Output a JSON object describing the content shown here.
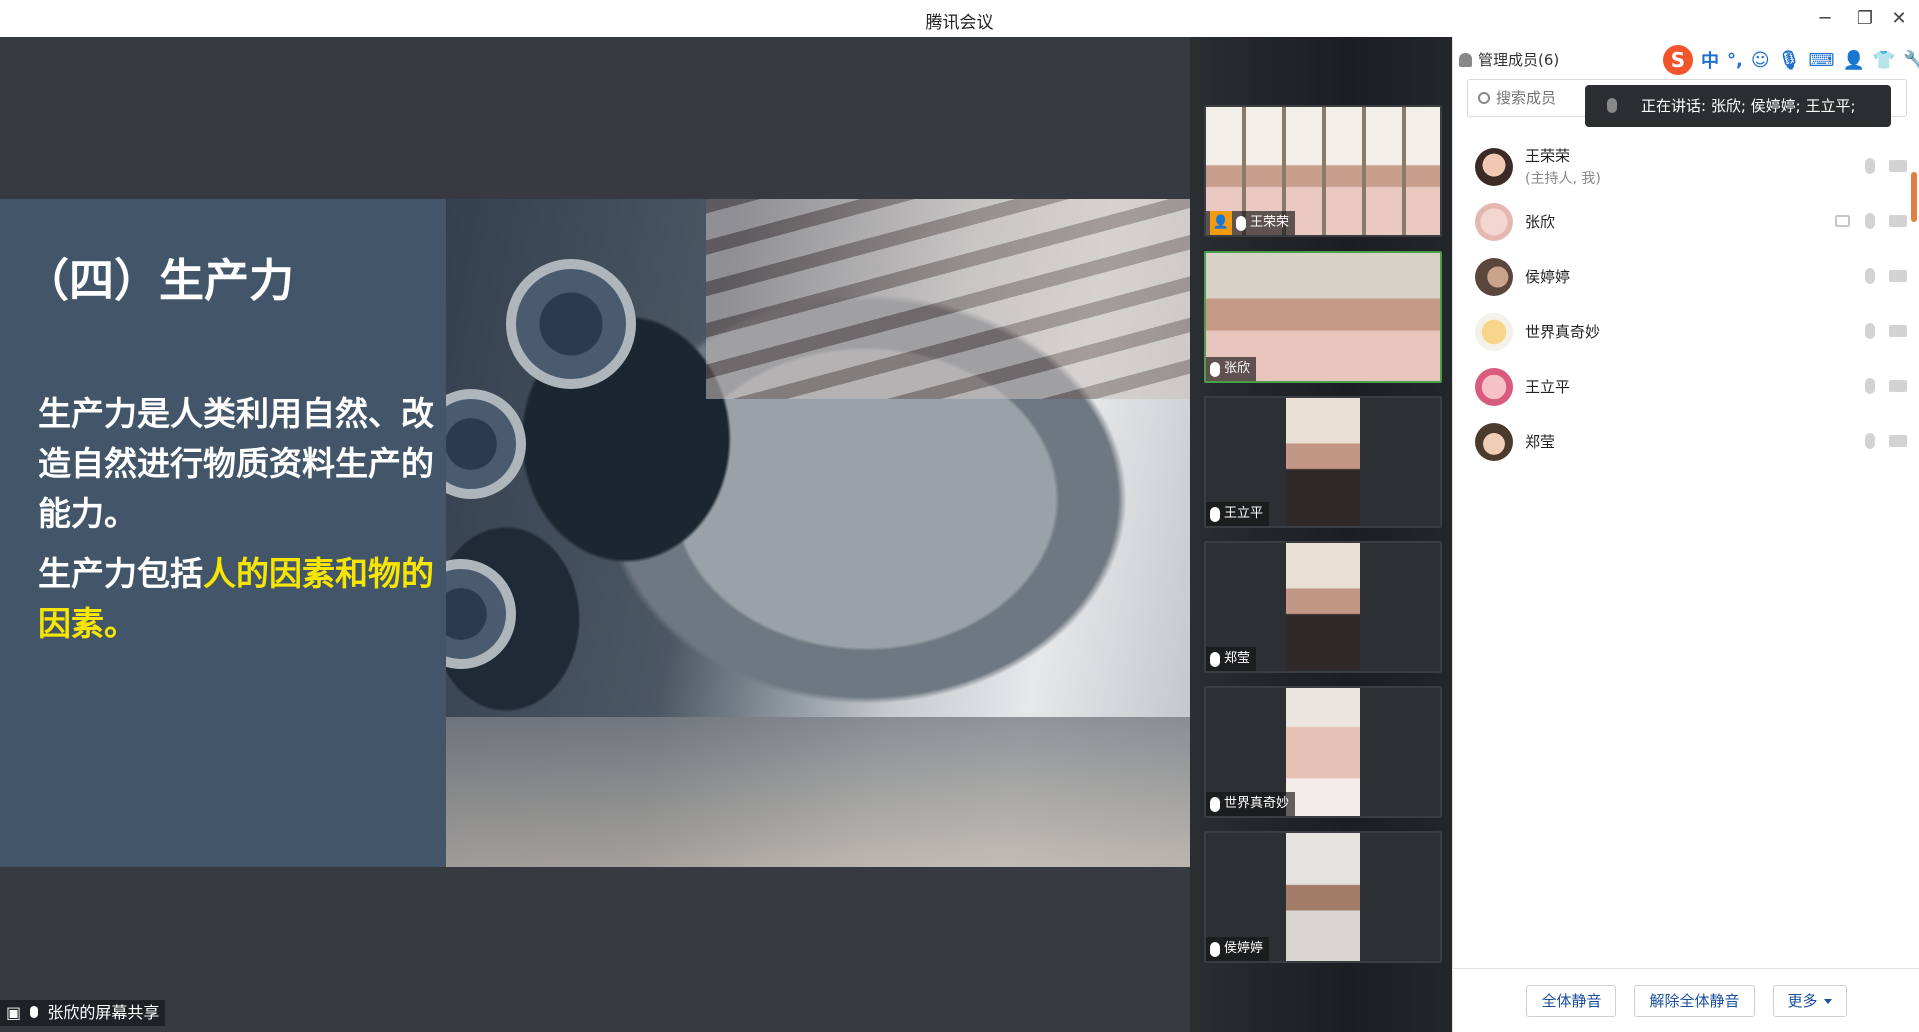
{
  "window": {
    "title": "腾讯会议",
    "minimize": "─",
    "restore": "❐",
    "close": "✕"
  },
  "slide": {
    "title": "（四）生产力",
    "body_1": "生产力是人类利用自然、改造自然进行物质资料生产的能力。",
    "body_2_prefix": "生产力包括",
    "body_2_highlight": "人的因素和物的因素。",
    "highlight_color": "#f7e600",
    "background_color": "#435569"
  },
  "share_label": "张欣的屏幕共享",
  "video_tiles": [
    {
      "name": "王荣荣",
      "host": true
    },
    {
      "name": "张欣",
      "active_speaker": true
    },
    {
      "name": "王立平"
    },
    {
      "name": "郑莹"
    },
    {
      "name": "世界真奇妙"
    },
    {
      "name": "侯婷婷"
    }
  ],
  "panel": {
    "header": "管理成员(6)",
    "search_placeholder": "搜索成员",
    "speaking_tooltip": "正在讲话: 张欣; 侯婷婷; 王立平;",
    "ime": {
      "logo": "S",
      "mode": "中",
      "punct": "°,"
    },
    "members": [
      {
        "name": "王荣荣",
        "role": "(主持人, 我)"
      },
      {
        "name": "张欣",
        "sharing": true
      },
      {
        "name": "侯婷婷"
      },
      {
        "name": "世界真奇妙"
      },
      {
        "name": "王立平"
      },
      {
        "name": "郑莹"
      }
    ],
    "buttons": {
      "mute_all": "全体静音",
      "unmute_all": "解除全体静音",
      "more": "更多"
    }
  },
  "colors": {
    "stage": "#373a40",
    "active_border": "#4aa04a",
    "host_badge": "#f39c12",
    "button_text": "#1a4fa0"
  }
}
